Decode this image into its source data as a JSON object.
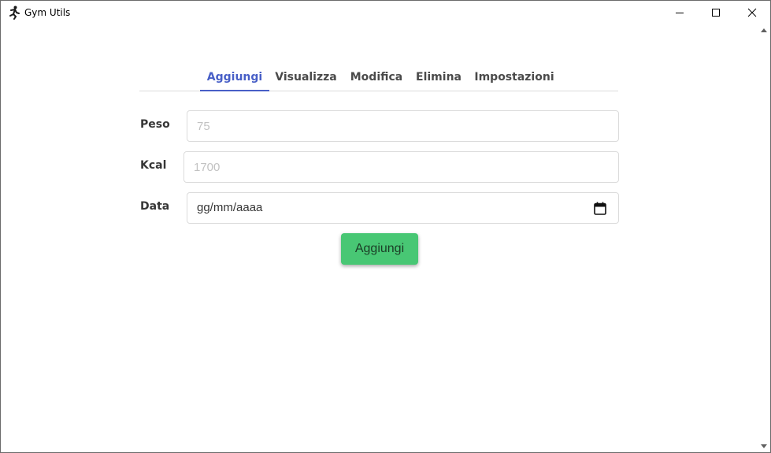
{
  "window": {
    "title": "Gym Utils",
    "icon": "running-figure-icon",
    "controls": [
      "minimize-icon",
      "maximize-icon",
      "close-icon"
    ]
  },
  "tabs": [
    {
      "label": "Aggiungi",
      "active": true
    },
    {
      "label": "Visualizza",
      "active": false
    },
    {
      "label": "Modifica",
      "active": false
    },
    {
      "label": "Elimina",
      "active": false
    },
    {
      "label": "Impostazioni",
      "active": false
    }
  ],
  "form": {
    "peso": {
      "label": "Peso",
      "placeholder": "75",
      "value": ""
    },
    "kcal": {
      "label": "Kcal",
      "placeholder": "1700",
      "value": ""
    },
    "data": {
      "label": "Data",
      "value": "gg/mm/aaaa",
      "icon": "calendar-icon"
    },
    "submit_label": "Aggiungi"
  },
  "colors": {
    "accent": "#485fc7",
    "submit": "#48c774"
  }
}
